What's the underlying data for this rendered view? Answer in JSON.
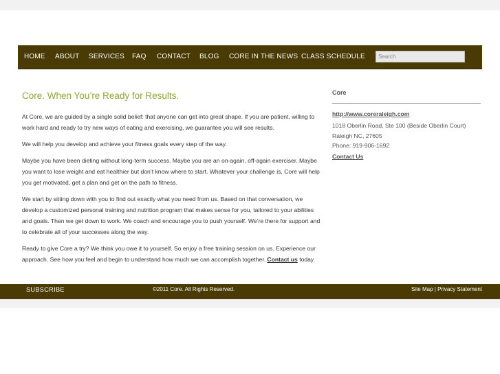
{
  "nav": {
    "items": [
      "HOME",
      "ABOUT",
      "SERVICES",
      "FAQ",
      "CONTACT",
      "BLOG",
      "CORE IN THE NEWS",
      "CLASS SCHEDULE"
    ],
    "search_placeholder": "Search"
  },
  "main": {
    "heading": "Core. When You’re Ready for Results.",
    "p1": "At Core, we are guided by a single solid belief: that anyone can get into great shape. If you are patient, willing to work hard and ready to try new ways of eating and exercising, we guarantee you will see results.",
    "p2": "We will help you develop and achieve your fitness goals every step of the way.",
    "p3": "Maybe you have been dieting without long-term success. Maybe you are an on-again, off-again exerciser. Maybe you want to lose weight and eat healthier but don’t know where to start. Whatever your challenge is, Core will help you get motivated, get a plan and get on the path to fitness.",
    "p4": "We start by sitting down with you to find out exactly what you need from us. Based on that conversation, we develop a customized personal training and nutrition program that makes sense for you, tailored to your abilities and goals. Then we get down to work. We coach and encourage you to push yourself. We’re there for support and to celebrate all of your successes along the way.",
    "p5_text": "Ready to give Core a try? We think you owe it to yourself. So enjoy a free training session on us. Experience our approach. See how you feel and begin to understand how much we can accomplish together.",
    "p5_link": "Contact us",
    "p5_end": "today."
  },
  "sidebar": {
    "title": "Core",
    "url": "http://www.coreraleigh.com",
    "address1": "1018 Oberlin Road, Ste 100 (Beside Oberlin Court)",
    "address2": "Raleigh NC, 27605",
    "phone": "Phone: 919-906-1692",
    "contact_link": "Contact Us"
  },
  "footer": {
    "subscribe": "SUBSCRIBE",
    "copyright": "©2011 Core. All Rights Reserved.",
    "sitemap": "Site Map",
    "separator": "|",
    "privacy": "Privacy Statement"
  },
  "colors": {
    "nav_bg": "#4a3b05",
    "heading": "#8aaa2f"
  }
}
